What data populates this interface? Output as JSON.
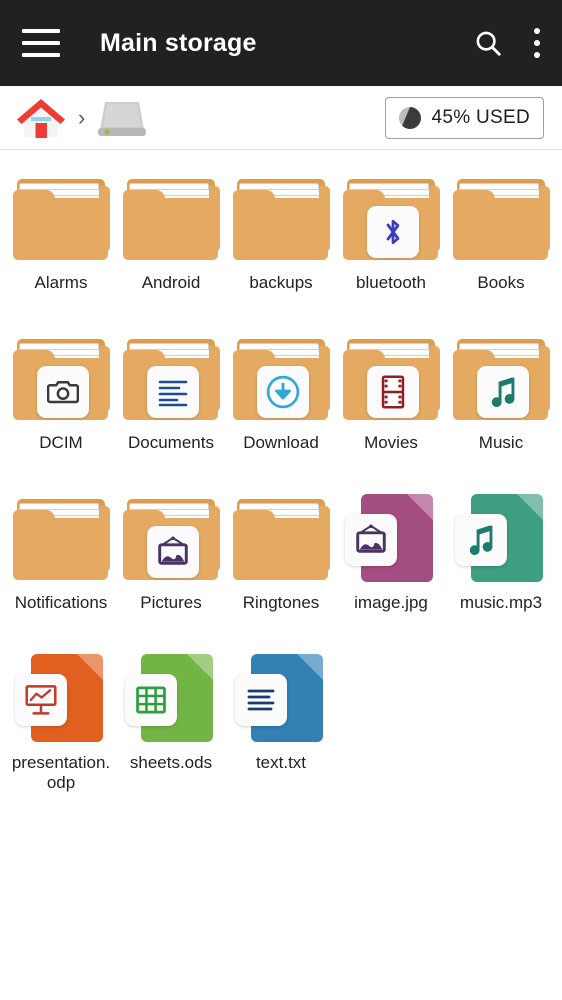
{
  "appbar": {
    "menu_icon": "hamburger-menu-icon",
    "title": "Main storage",
    "search_icon": "search-icon",
    "overflow_icon": "more-vertical-icon"
  },
  "breadcrumb": {
    "home_icon": "home-icon",
    "separator": "›",
    "storage_icon": "hard-drive-icon",
    "usage": {
      "pie_icon": "pie-chart-icon",
      "label": "45% USED",
      "percent": 45
    }
  },
  "colors": {
    "appbar_bg": "#212121",
    "folder": "#e5aa62",
    "folder_dark": "#dd9c4e",
    "image_file": "#a44d82",
    "audio_file": "#3e9e82",
    "presentation_file": "#e2601f",
    "spreadsheet_file": "#72b544",
    "text_file": "#3380b5",
    "label_text": "#222222"
  },
  "grid": {
    "columns": 5,
    "items": [
      {
        "label": "Alarms",
        "type": "folder",
        "badge": "none"
      },
      {
        "label": "Android",
        "type": "folder",
        "badge": "none"
      },
      {
        "label": "backups",
        "type": "folder",
        "badge": "none"
      },
      {
        "label": "bluetooth",
        "type": "folder",
        "badge": "bluetooth-icon"
      },
      {
        "label": "Books",
        "type": "folder",
        "badge": "none"
      },
      {
        "label": "DCIM",
        "type": "folder",
        "badge": "camera-icon"
      },
      {
        "label": "Documents",
        "type": "folder",
        "badge": "document-lines-icon"
      },
      {
        "label": "Download",
        "type": "folder",
        "badge": "download-arrow-icon"
      },
      {
        "label": "Movies",
        "type": "folder",
        "badge": "film-strip-icon"
      },
      {
        "label": "Music",
        "type": "folder",
        "badge": "music-note-icon"
      },
      {
        "label": "Notifications",
        "type": "folder",
        "badge": "none"
      },
      {
        "label": "Pictures",
        "type": "folder",
        "badge": "picture-frame-icon"
      },
      {
        "label": "Ringtones",
        "type": "folder",
        "badge": "none"
      },
      {
        "label": "image.jpg",
        "type": "file",
        "badge": "picture-frame-icon",
        "color": "#a44d82"
      },
      {
        "label": "music.mp3",
        "type": "file",
        "badge": "music-note-icon",
        "color": "#3e9e82"
      },
      {
        "label": "presentation.odp",
        "type": "file",
        "badge": "presentation-icon",
        "color": "#e2601f"
      },
      {
        "label": "sheets.ods",
        "type": "file",
        "badge": "spreadsheet-icon",
        "color": "#72b544"
      },
      {
        "label": "text.txt",
        "type": "file",
        "badge": "text-lines-icon",
        "color": "#3380b5"
      }
    ]
  }
}
